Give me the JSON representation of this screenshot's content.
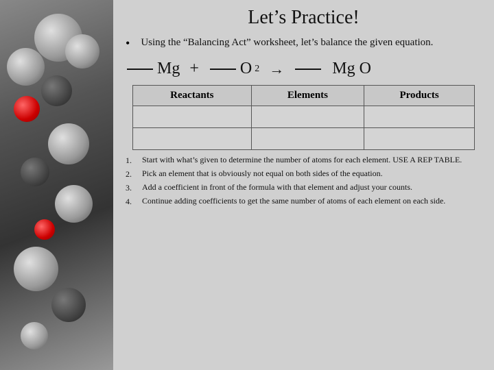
{
  "title": "Let’s Practice!",
  "bullet_text": "Using the “Balancing Act” worksheet, let’s balance the given equation.",
  "equation": {
    "blank1": "____",
    "element1": "Mg",
    "plus": "+",
    "blank2": "____",
    "element2": "O",
    "subscript2": "2",
    "arrow": "→",
    "blank3": "____",
    "element3": "Mg O"
  },
  "table": {
    "headers": [
      "Reactants",
      "Elements",
      "Products"
    ],
    "rows": [
      [
        "",
        "",
        ""
      ],
      [
        "",
        "",
        ""
      ]
    ]
  },
  "steps": [
    {
      "num": "1.",
      "text": "Start with what’s given to determine the number of atoms for each element. USE A REP TABLE."
    },
    {
      "num": "2.",
      "text": "Pick an element that is obviously not equal on both sides of the equation."
    },
    {
      "num": "3.",
      "text": "Add a coefficient in front of the formula with that element and adjust your counts."
    },
    {
      "num": "4.",
      "text": "Continue adding coefficients to get the same number of atoms of each element on each side."
    }
  ]
}
